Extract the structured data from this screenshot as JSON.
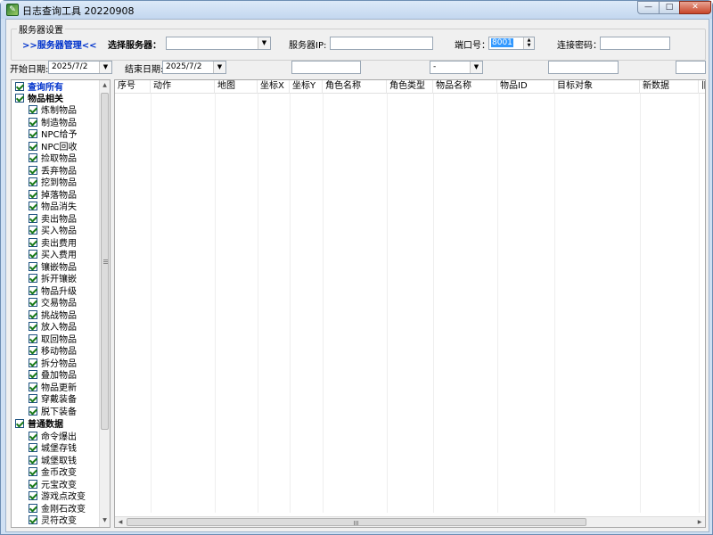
{
  "window": {
    "title": "日志查询工具 20220908",
    "icon": "app-icon",
    "buttons": {
      "minimize": "—",
      "maximize": "□",
      "close": "✕"
    }
  },
  "server": {
    "group_title": "服务器设置",
    "manage_link": ">>服务器管理<<",
    "select_label": "选择服务器：",
    "select_value": "",
    "ip_label": "服务器IP:",
    "ip_value": "",
    "port_label": "端口号：",
    "port_value": "8001",
    "password_label": "连接密码：",
    "password_value": ""
  },
  "filters": {
    "start_label": "开始日期:",
    "start_value": "2025/7/2",
    "end_label": "结束日期:",
    "end_value": "2025/7/2",
    "text1": "",
    "combo_value": "-",
    "text2": "",
    "text3": ""
  },
  "tree": {
    "root_all": "查询所有",
    "group1": "物品相关",
    "group1_items": [
      "炼制物品",
      "制造物品",
      "NPC给予",
      "NPC回收",
      "捡取物品",
      "丢弃物品",
      "挖到物品",
      "掉落物品",
      "物品消失",
      "卖出物品",
      "买入物品",
      "卖出费用",
      "买入费用",
      "镶嵌物品",
      "拆开镶嵌",
      "物品升级",
      "交易物品",
      "挑战物品",
      "放入物品",
      "取回物品",
      "移动物品",
      "拆分物品",
      "叠加物品",
      "物品更新",
      "穿戴装备",
      "脱下装备"
    ],
    "group2": "普通数据",
    "group2_items": [
      "命令爆出",
      "城堡存钱",
      "城堡取钱",
      "金币改变",
      "元宝改变",
      "游戏点改变",
      "金刚石改变",
      "灵符改变"
    ]
  },
  "grid": {
    "columns": [
      "序号",
      "动作",
      "地图",
      "坐标X",
      "坐标Y",
      "角色名称",
      "角色类型",
      "物品名称",
      "物品ID",
      "目标对象",
      "新数据",
      "旧"
    ]
  }
}
